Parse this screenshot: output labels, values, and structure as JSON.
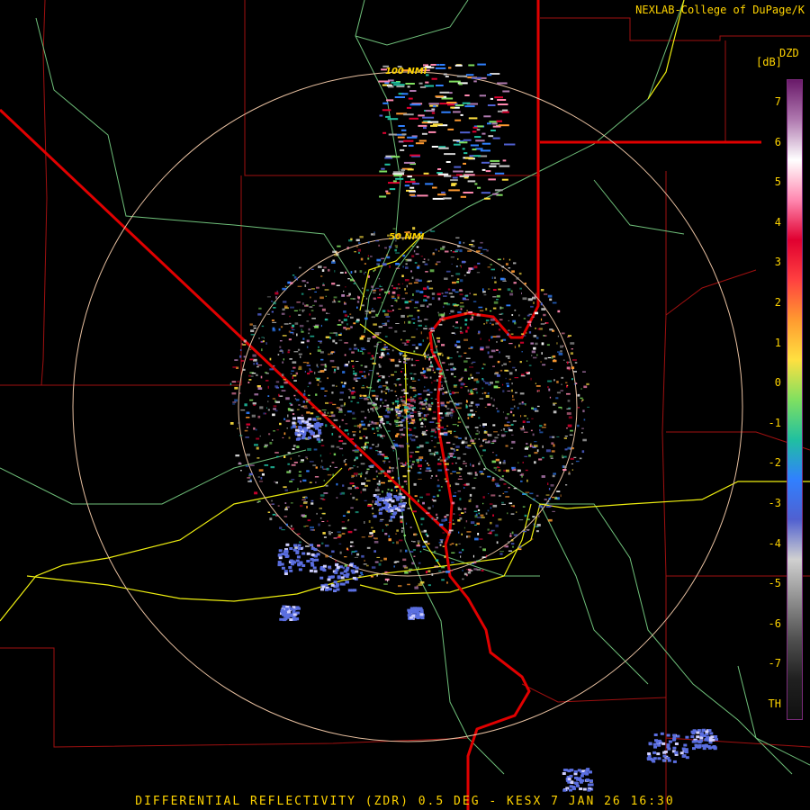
{
  "credit": "NEXLAB-College of DuPage/K",
  "product_code": "DZD",
  "unit": "[dB]",
  "footer": "DIFFERENTIAL REFLECTIVITY (ZDR) 0.5 DEG - KESX 7 JAN 26 16:30",
  "range_rings": [
    "100 NMI",
    "50 NMI"
  ],
  "colorbar": {
    "ticks": [
      "7",
      "6",
      "5",
      "4",
      "3",
      "2",
      "1",
      "0",
      "-1",
      "-2",
      "-3",
      "-4",
      "-5",
      "-6",
      "-7",
      "TH"
    ],
    "stops": [
      "#6a1a6a",
      "#b07ab0",
      "#ffffff",
      "#ff88b0",
      "#e00030",
      "#ff4040",
      "#ff9a30",
      "#ffe040",
      "#80e060",
      "#20c0a0",
      "#3080ff",
      "#5060d0",
      "#d0d0d0",
      "#909090",
      "#505050",
      "#202020",
      "#101010"
    ]
  },
  "colors": {
    "state_border": "#e00000",
    "county_line": "#b01010",
    "road": "#f0f000",
    "highway": "#7fd08a",
    "ring": "#f0c8a0"
  }
}
